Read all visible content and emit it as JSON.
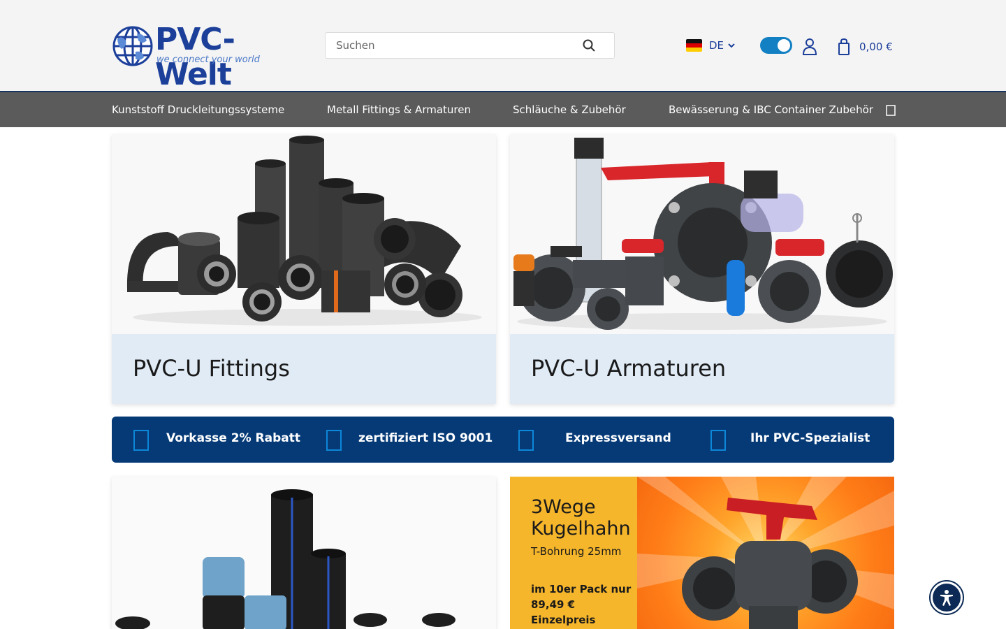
{
  "colors": {
    "brand_blue": "#1c3f9a",
    "nav_bg": "#5b5b5b",
    "usp_bg": "#053a77",
    "card_caption_bg": "#e0ebf6",
    "toggle_on": "#1380c4",
    "promo_yellow": "#f6b62b",
    "promo_orange": "#ff8a1e"
  },
  "header": {
    "logo": {
      "name": "PVC-Welt",
      "tagline": "we connect your world",
      "icon": "globe-icon"
    },
    "search": {
      "placeholder": "Suchen",
      "icon": "search-icon"
    },
    "language": {
      "code": "DE",
      "flag": "germany-flag-icon",
      "icon": "chevron-down-icon"
    },
    "toggle": {
      "state": "on"
    },
    "account": {
      "icon": "user-icon"
    },
    "cart": {
      "icon": "shopping-bag-icon",
      "total": "0,00 €"
    }
  },
  "nav": {
    "items": [
      {
        "label": "Kunststoff Druckleitungssysteme"
      },
      {
        "label": "Metall Fittings & Armaturen"
      },
      {
        "label": "Schläuche & Zubehör"
      },
      {
        "label": "Bewässerung & IBC Container Zubehör"
      }
    ],
    "more_icon": "chevron-down-icon"
  },
  "categories": [
    {
      "title": "PVC-U Fittings"
    },
    {
      "title": "PVC-U Armaturen"
    }
  ],
  "usp": [
    {
      "icon": "piggy-bank-icon",
      "label": "Vorkasse 2% Rabatt"
    },
    {
      "icon": "certificate-icon",
      "label": "zertifiziert ISO 9001"
    },
    {
      "icon": "truck-icon",
      "label": "Expressversand"
    },
    {
      "icon": "thumbs-up-icon",
      "label": "Ihr PVC-Spezialist"
    }
  ],
  "promo": {
    "title": "3Wege Kugelhahn",
    "subtitle": "T-Bohrung 25mm",
    "price_text": "im 10er Pack nur 89,49 € Einzelpreis"
  },
  "accessibility": {
    "icon": "accessibility-icon"
  }
}
